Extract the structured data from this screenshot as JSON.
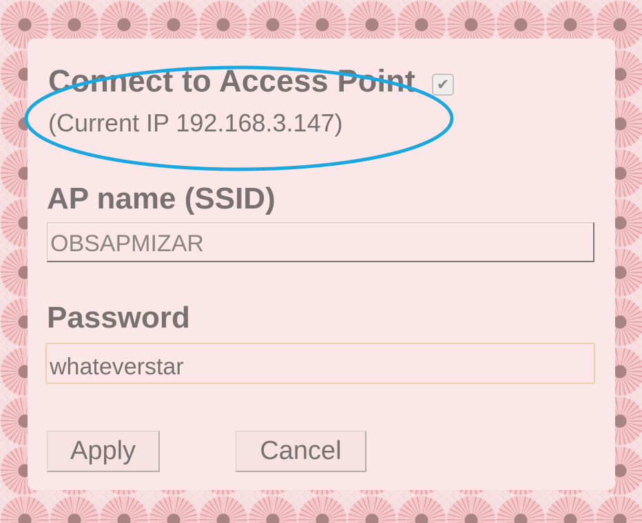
{
  "dialog": {
    "title": "Connect to Access Point",
    "connect_checked": true,
    "checkbox_glyph": "✔",
    "current_ip": "(Current IP 192.168.3.147)",
    "ssid_label": "AP name (SSID)",
    "ssid_value": "OBSAPMIZAR",
    "password_label": "Password",
    "password_value": "whateverstar",
    "apply_label": "Apply",
    "cancel_label": "Cancel"
  },
  "colors": {
    "panel_background": "#fbe7e8",
    "text": "#777171",
    "highlight_ellipse": "#1ba8e0",
    "password_border": "#efcfa9"
  },
  "icons": {
    "checkbox": "check-icon"
  }
}
